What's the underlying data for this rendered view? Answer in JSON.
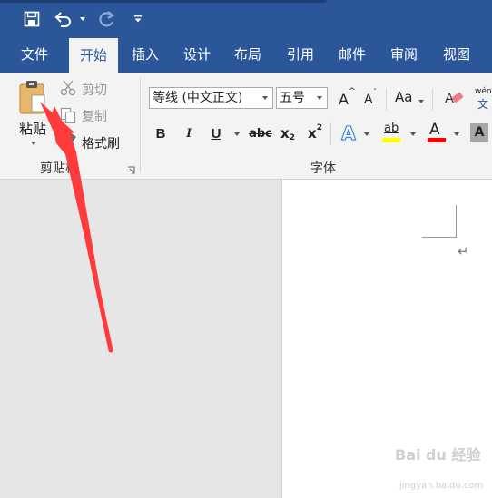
{
  "quick_access": {
    "save_icon": "save-icon",
    "undo_icon": "undo-icon",
    "redo_icon": "redo-icon",
    "customize_icon": "customize-icon"
  },
  "tabs": [
    "文件",
    "开始",
    "插入",
    "设计",
    "布局",
    "引用",
    "邮件",
    "审阅",
    "视图"
  ],
  "active_tab": "开始",
  "clipboard": {
    "paste_label": "粘贴",
    "cut_label": "剪切",
    "copy_label": "复制",
    "format_painter_label": "格式刷",
    "group_label": "剪贴板"
  },
  "font": {
    "font_name": "等线 (中文正文)",
    "font_size": "五号",
    "bold": "B",
    "italic": "I",
    "underline": "U",
    "strikethrough": "abc",
    "subscript_base": "x",
    "subscript_mark": "2",
    "superscript_base": "x",
    "superscript_mark": "2",
    "change_case": "Aa",
    "grow_font": "A",
    "shrink_font": "A",
    "text_effects": "A",
    "highlight": "ab",
    "font_color": "A",
    "char_shading": "A",
    "phonetic_top": "wén",
    "phonetic_bottom": "文",
    "group_label": "字体"
  },
  "colors": {
    "ribbon_blue": "#2b579a",
    "highlight_yellow": "#ffff00",
    "font_color_red": "#ff0000",
    "annotation_arrow": "#ff3b3b"
  },
  "watermark": {
    "text": "Bai du 经验",
    "sub": "jingyan.baidu.com"
  }
}
